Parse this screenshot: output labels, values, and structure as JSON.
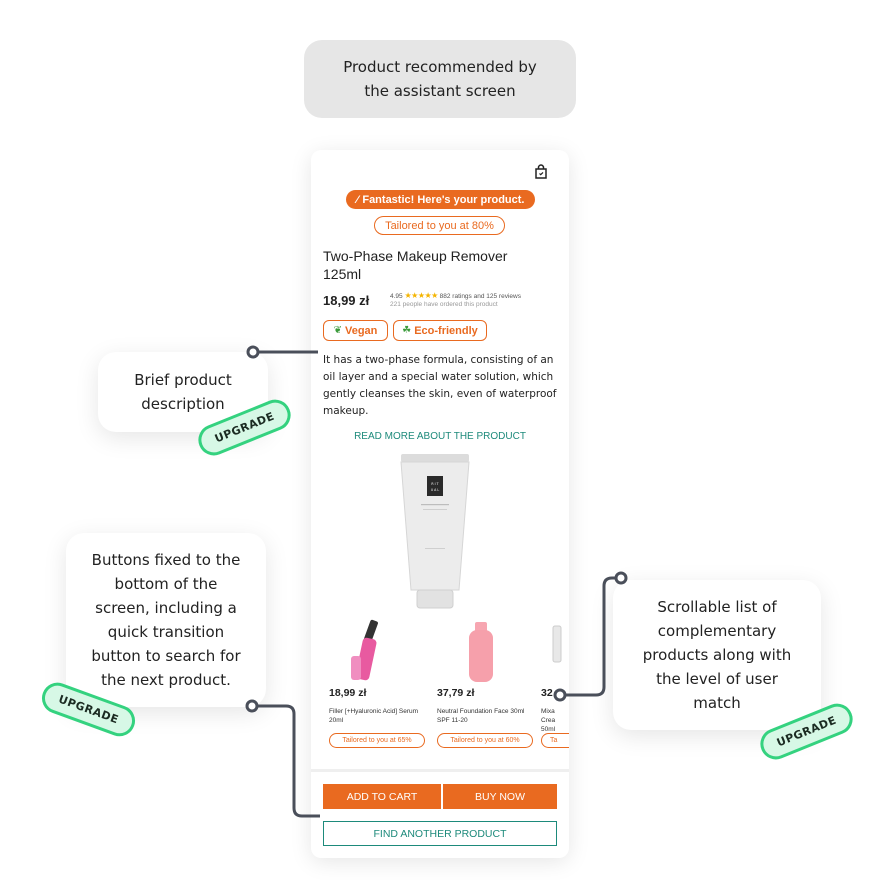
{
  "page_title": "Product recommended by\nthe assistant screen",
  "callouts": {
    "description": "Brief product\ndescription",
    "buttons": "Buttons fixed to the\nbottom of the\nscreen, including a\nquick transition\nbutton to search for\nthe next product.",
    "list": "Scrollable list of\ncomplementary\nproducts along with\nthe level of user\nmatch"
  },
  "upgrade_tag": "UPGRADE",
  "phone": {
    "banner": "Fantastic! Here's your product.",
    "match": "Tailored to you at 80%",
    "product_name": "Two-Phase Makeup Remover 125ml",
    "price": "18,99 zł",
    "rating": {
      "score": "4.95",
      "stars": "★★★★★",
      "reviews": "882 ratings and 125 reviews",
      "orders": "221 people have ordered this product"
    },
    "badges": [
      {
        "label": "Vegan",
        "icon": "leaf-icon"
      },
      {
        "label": "Eco-friendly",
        "icon": "clover-icon"
      }
    ],
    "description": "It has a two-phase formula, consisting of an oil layer and a special water solution, which gently cleanses the skin, even of waterproof makeup.",
    "read_more": "READ MORE ABOUT THE PRODUCT",
    "recommendations": [
      {
        "price": "18,99 zł",
        "name": "Filler [+Hyaluronic Acid] Serum 20ml",
        "match": "Tailored to you at 65%"
      },
      {
        "price": "37,79 zł",
        "name": "Neutral Foundation Face 30ml SPF 11-20",
        "match": "Tailored to you at 60%"
      },
      {
        "price": "32",
        "name": "Mixa Crea 50ml",
        "match": "Ta"
      }
    ],
    "buttons": {
      "add_to_cart": "ADD TO CART",
      "buy_now": "BUY NOW",
      "find_another": "FIND ANOTHER PRODUCT"
    }
  },
  "colors": {
    "accent_orange": "#e96a20",
    "teal": "#1d8a7b",
    "tag_green": "#34d27f"
  }
}
